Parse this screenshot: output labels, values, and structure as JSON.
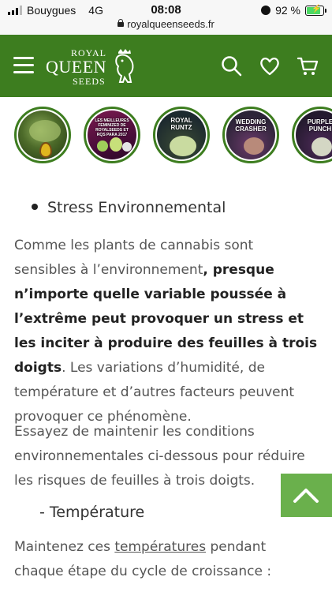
{
  "status_bar": {
    "carrier": "Bouygues",
    "network": "4G",
    "time": "08:08",
    "battery": "92 %",
    "battery_level": 0.92,
    "url": "royalqueenseeds.fr"
  },
  "header": {
    "logo_top": "ROYAL",
    "logo_middle": "QUEEN",
    "logo_bottom": "SEEDS",
    "bg_color": "#3d7d1f",
    "icons": [
      "hamburger-icon",
      "search-icon",
      "heart-icon",
      "cart-icon"
    ]
  },
  "categories": [
    {
      "name": "category-1",
      "label": ""
    },
    {
      "name": "category-2",
      "label": "LES MEILLEURES FEMINIZED DE ROYALSEEDS ET RQS PARA 2017"
    },
    {
      "name": "category-3",
      "label": "ROYAL RUNTZ"
    },
    {
      "name": "category-4",
      "label": "WEDDING CRASHER"
    },
    {
      "name": "category-5",
      "label": "PURPLE PUNCH"
    }
  ],
  "article": {
    "bullet_heading": "Stress Environnemental",
    "p1_start": "Comme les plants de cannabis sont sensibles à l’environnement",
    "p1_bold": ", presque n’importe quelle variable poussée à l’extrême peut provoquer un stress et les inciter à produire des feuilles à trois doigts",
    "p1_end": ". Les variations d’humidité, de température et d’autres facteurs peuvent provoquer ce phénomène.",
    "p2": "Essayez de maintenir les conditions environnementales ci-dessous pour réduire les risques de feuilles à trois doigts.",
    "subheading": "- Température",
    "p3_start": "Maintenez ces ",
    "p3_link": "températures",
    "p3_end": " pendant chaque étape du cycle de croissance :"
  }
}
